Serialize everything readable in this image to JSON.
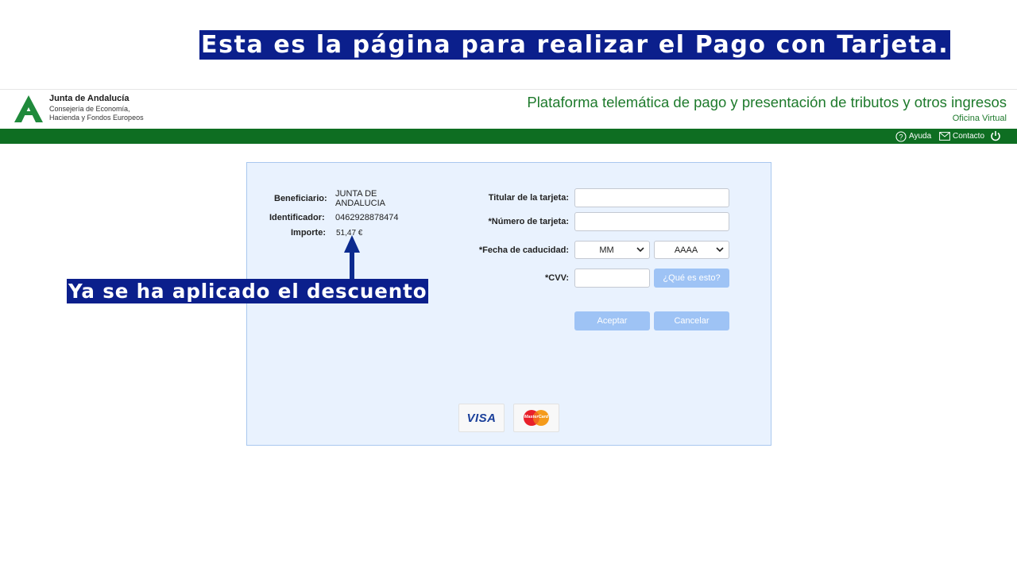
{
  "captions": {
    "top": "Esta es la página para realizar el Pago con Tarjeta.",
    "note": "Ya se ha aplicado el descuento"
  },
  "header": {
    "org_name": "Junta de Andalucía",
    "org_sub1": "Consejería de Economía,",
    "org_sub2": "Hacienda y Fondos Europeos",
    "platform_title": "Plataforma telemática de pago y presentación de tributos y otros ingresos",
    "office_label": "Oficina Virtual",
    "logo_icon": "junta-andalucia-logo",
    "brand_green": "#0e6e22"
  },
  "topbar": {
    "help_label": "Ayuda",
    "contact_label": "Contacto",
    "help_icon": "help-circle-icon",
    "contact_icon": "envelope-icon",
    "power_icon": "power-icon"
  },
  "payment": {
    "beneficiary_label": "Beneficiario:",
    "beneficiary_line1": "JUNTA DE",
    "beneficiary_line2": "ANDALUCIA",
    "identifier_label": "Identificador:",
    "identifier_value": "0462928878474",
    "amount_label": "Importe:",
    "amount_value": "51,47 €"
  },
  "form": {
    "holder_label": "Titular de la tarjeta:",
    "holder_value": "",
    "card_number_label": "*Número de tarjeta:",
    "card_number_value": "",
    "expiry_label": "*Fecha de caducidad:",
    "month_selected": "MM",
    "year_selected": "AAAA",
    "cvv_label": "*CVV:",
    "cvv_value": "",
    "cvv_help_button": "¿Qué es esto?",
    "accept_button": "Aceptar",
    "cancel_button": "Cancelar",
    "button_color": "#9ec3f5"
  },
  "cards": {
    "visa_text": "VISA",
    "mastercard_text": "MasterCard"
  }
}
